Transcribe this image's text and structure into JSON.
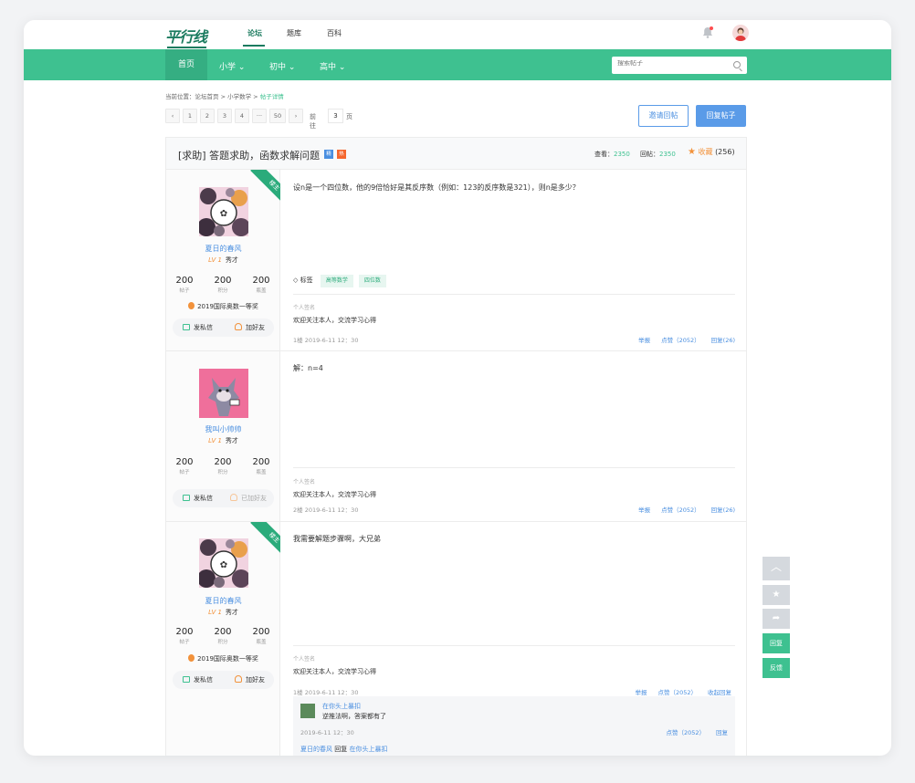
{
  "header": {
    "logo": "平行线",
    "nav": [
      "论坛",
      "题库",
      "百科"
    ]
  },
  "greenbar": {
    "home": "首页",
    "menus": [
      "小学",
      "初中",
      "高中"
    ],
    "search_placeholder": "搜索帖子"
  },
  "breadcrumb": {
    "prefix": "当前位置：",
    "items": [
      "论坛首页",
      "小学数学"
    ],
    "current": "帖子详情",
    "sep": " > "
  },
  "pager": {
    "prev": "‹",
    "pages": [
      "1",
      "2",
      "3",
      "4",
      "···",
      "50"
    ],
    "next": "›",
    "goto": "前往",
    "input": "3",
    "suffix": "页"
  },
  "buttons": {
    "invite": "邀请回帖",
    "reply": "回复帖子"
  },
  "thread": {
    "title": "[求助] 答题求助，函数求解问题",
    "badge_jing": "精",
    "badge_hot": "热",
    "views_label": "查看：",
    "views": "2350",
    "replies_label": "回帖：",
    "replies": "2350",
    "fav_label": "收藏",
    "fav_count": "(256)"
  },
  "posts": [
    {
      "ribbon": "楼主",
      "name": "夏日的春风",
      "level": "LV 1",
      "title": "秀才",
      "stats": [
        {
          "v": "200",
          "l": "帖子"
        },
        {
          "v": "200",
          "l": "积分"
        },
        {
          "v": "200",
          "l": "瓶盖"
        }
      ],
      "honor": "2019国际奥数一等奖",
      "msg": "发私信",
      "friend": "加好友",
      "content": "设n是一个四位数，他的9倍恰好是其反序数（例如：123的反序数是321），则n是多少？",
      "tags_label": "标签",
      "tags": [
        "高等数学",
        "四位数"
      ],
      "sig_label": "个人签名",
      "sig": "欢迎关注本人，交流学习心得",
      "meta": "1楼  2019-6-11  12：30",
      "report": "举报",
      "like": "点赞（2052）",
      "reply": "回复(26)"
    },
    {
      "name": "我叫小帅帅",
      "level": "LV 1",
      "title": "秀才",
      "stats": [
        {
          "v": "200",
          "l": "帖子"
        },
        {
          "v": "200",
          "l": "积分"
        },
        {
          "v": "200",
          "l": "瓶盖"
        }
      ],
      "msg": "发私信",
      "friend": "已加好友",
      "content": "解：n=4",
      "sig_label": "个人签名",
      "sig": "欢迎关注本人，交流学习心得",
      "meta": "2楼  2019-6-11  12：30",
      "report": "举报",
      "like": "点赞（2052）",
      "reply": "回复(26)"
    },
    {
      "ribbon": "楼主",
      "name": "夏日的春风",
      "level": "LV 1",
      "title": "秀才",
      "stats": [
        {
          "v": "200",
          "l": "帖子"
        },
        {
          "v": "200",
          "l": "积分"
        },
        {
          "v": "200",
          "l": "瓶盖"
        }
      ],
      "honor": "2019国际奥数一等奖",
      "msg": "发私信",
      "friend": "加好友",
      "content": "我需要解题步骤啊，大兄弟",
      "sig_label": "个人签名",
      "sig": "欢迎关注本人，交流学习心得",
      "meta": "1楼  2019-6-11  12：30",
      "report": "举报",
      "like": "点赞（2052）",
      "reply": "收起回复",
      "replies": [
        {
          "name": "在你头上暴扣",
          "text": "逆推法啊，答案都有了",
          "meta": "2019-6-11  12：30",
          "like": "点赞（2052）",
          "reply": "回复"
        },
        {
          "name": "夏日的春风",
          "verb": "回复",
          "target": "在你头上暴扣"
        }
      ]
    }
  ],
  "float": {
    "reply": "回复",
    "feedback": "反馈"
  },
  "colors": {
    "brand": "#3ec190",
    "link": "#4a8fe0",
    "accent": "#f2923b"
  }
}
